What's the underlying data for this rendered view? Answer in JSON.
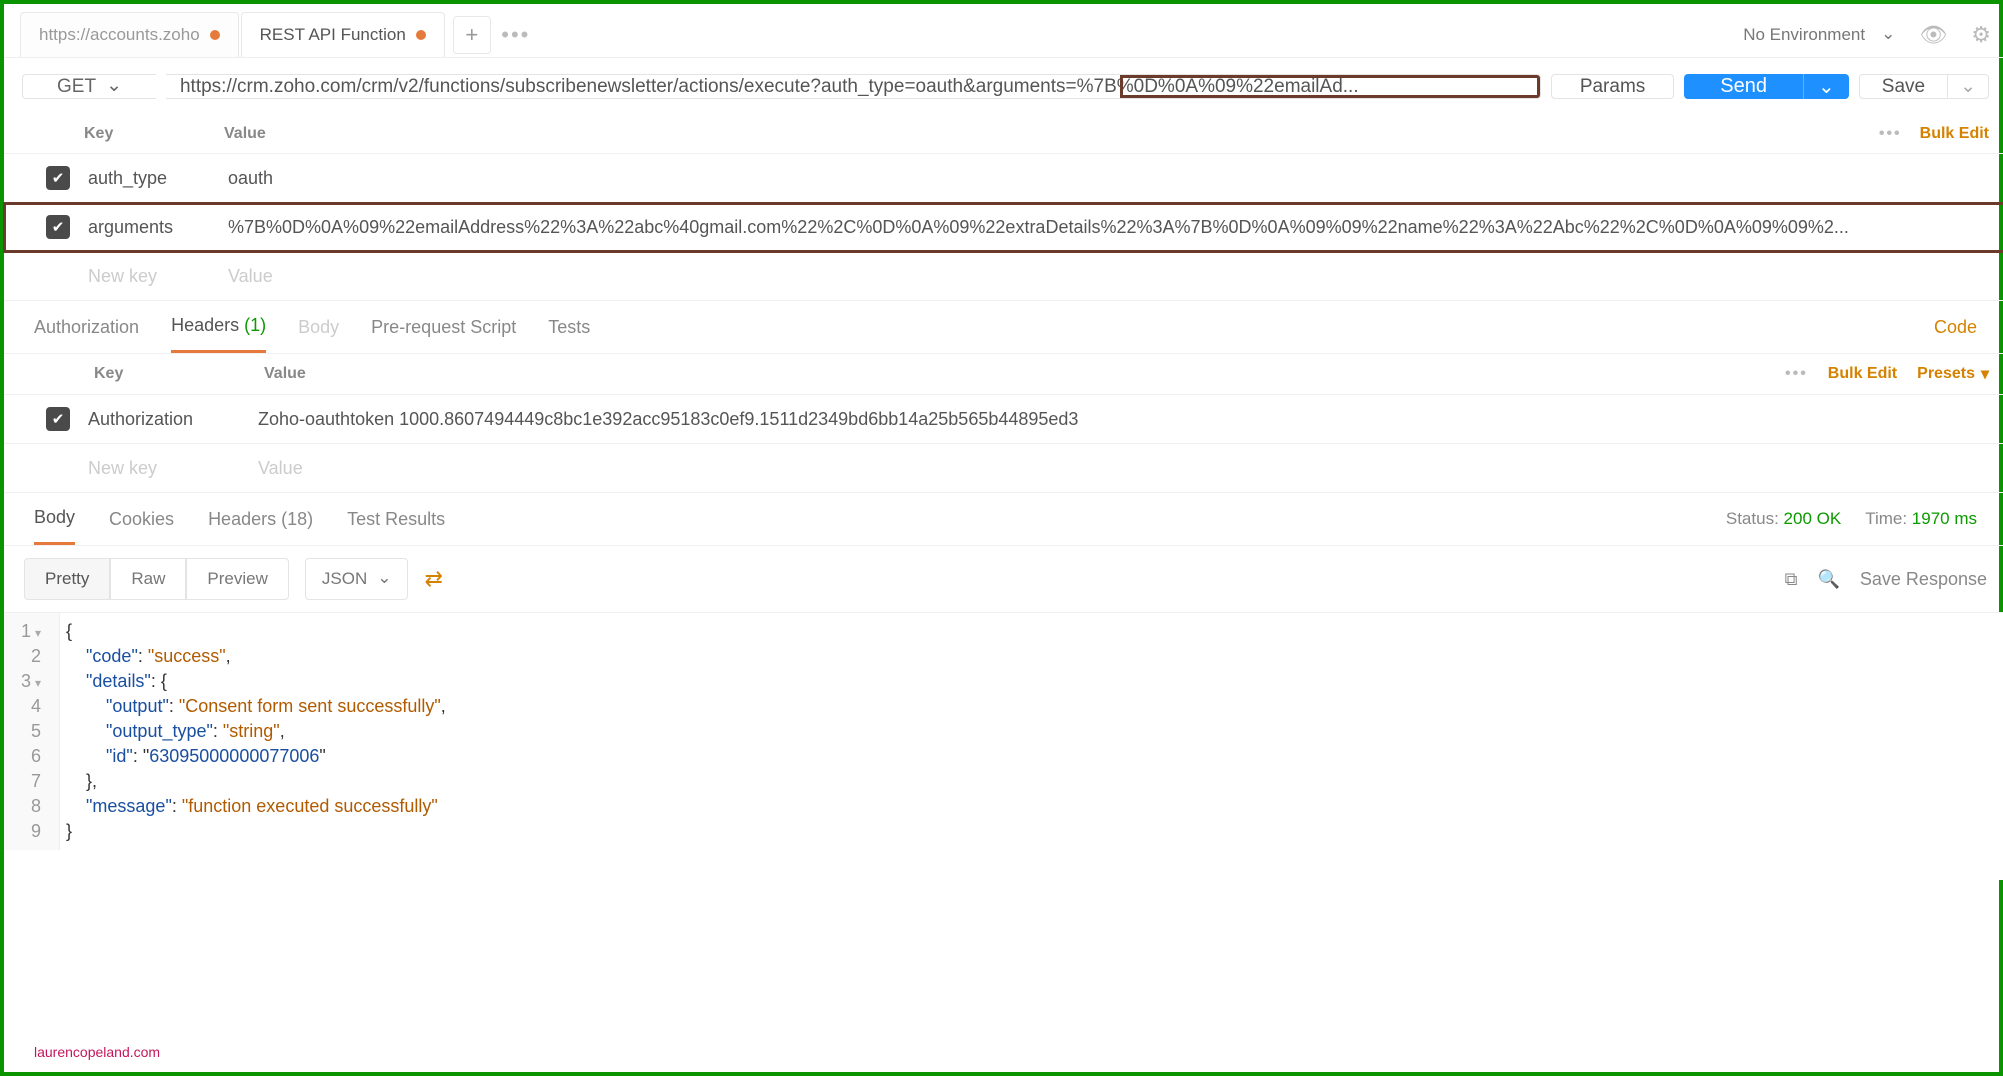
{
  "tabs": [
    {
      "label": "https://accounts.zoho",
      "dirty": true,
      "active": false
    },
    {
      "label": "REST API Function",
      "dirty": true,
      "active": true
    }
  ],
  "environment": {
    "label": "No Environment"
  },
  "request": {
    "method": "GET",
    "url": "https://crm.zoho.com/crm/v2/functions/subscribenewsletter/actions/execute?auth_type=oauth&arguments=%7B%0D%0A%09%22emailAd...",
    "params_btn": "Params",
    "send_btn": "Send",
    "save_btn": "Save"
  },
  "params_table": {
    "header_key": "Key",
    "header_value": "Value",
    "bulk_edit": "Bulk Edit",
    "rows": [
      {
        "checked": true,
        "key": "auth_type",
        "value": "oauth"
      },
      {
        "checked": true,
        "key": "arguments",
        "value": "%7B%0D%0A%09%22emailAddress%22%3A%22abc%40gmail.com%22%2C%0D%0A%09%22extraDetails%22%3A%7B%0D%0A%09%09%22name%22%3A%22Abc%22%2C%0D%0A%09%09%2..."
      }
    ],
    "new_key": "New key",
    "new_value": "Value"
  },
  "section_tabs": {
    "authorization": "Authorization",
    "headers": "Headers",
    "headers_count": "(1)",
    "body": "Body",
    "prerequest": "Pre-request Script",
    "tests": "Tests",
    "code": "Code"
  },
  "headers_table": {
    "header_key": "Key",
    "header_value": "Value",
    "bulk_edit": "Bulk Edit",
    "presets": "Presets",
    "rows": [
      {
        "checked": true,
        "key": "Authorization",
        "value": "Zoho-oauthtoken 1000.8607494449c8bc1e392acc95183c0ef9.1511d2349bd6bb14a25b565b44895ed3"
      }
    ],
    "new_key": "New key",
    "new_value": "Value"
  },
  "response_tabs": {
    "body": "Body",
    "cookies": "Cookies",
    "headers": "Headers",
    "headers_count": "(18)",
    "test_results": "Test Results",
    "status_label": "Status:",
    "status_value": "200 OK",
    "time_label": "Time:",
    "time_value": "1970 ms"
  },
  "view_bar": {
    "pretty": "Pretty",
    "raw": "Raw",
    "preview": "Preview",
    "format": "JSON",
    "save_response": "Save Response"
  },
  "response_body": {
    "lines": [
      "1",
      "2",
      "3",
      "4",
      "5",
      "6",
      "7",
      "8",
      "9"
    ],
    "tokens": {
      "l1": "{",
      "l2k": "\"code\"",
      "l2v": "\"success\"",
      "l3k": "\"details\"",
      "l4k": "\"output\"",
      "l4v": "\"Consent form sent successfully\"",
      "l5k": "\"output_type\"",
      "l5v": "\"string\"",
      "l6k": "\"id\"",
      "l6v": "\"63095000000077006\"",
      "l7": "},",
      "l8k": "\"message\"",
      "l8v": "\"function executed successfully\"",
      "l9": "}"
    }
  },
  "watermark": "laurencopeland.com"
}
